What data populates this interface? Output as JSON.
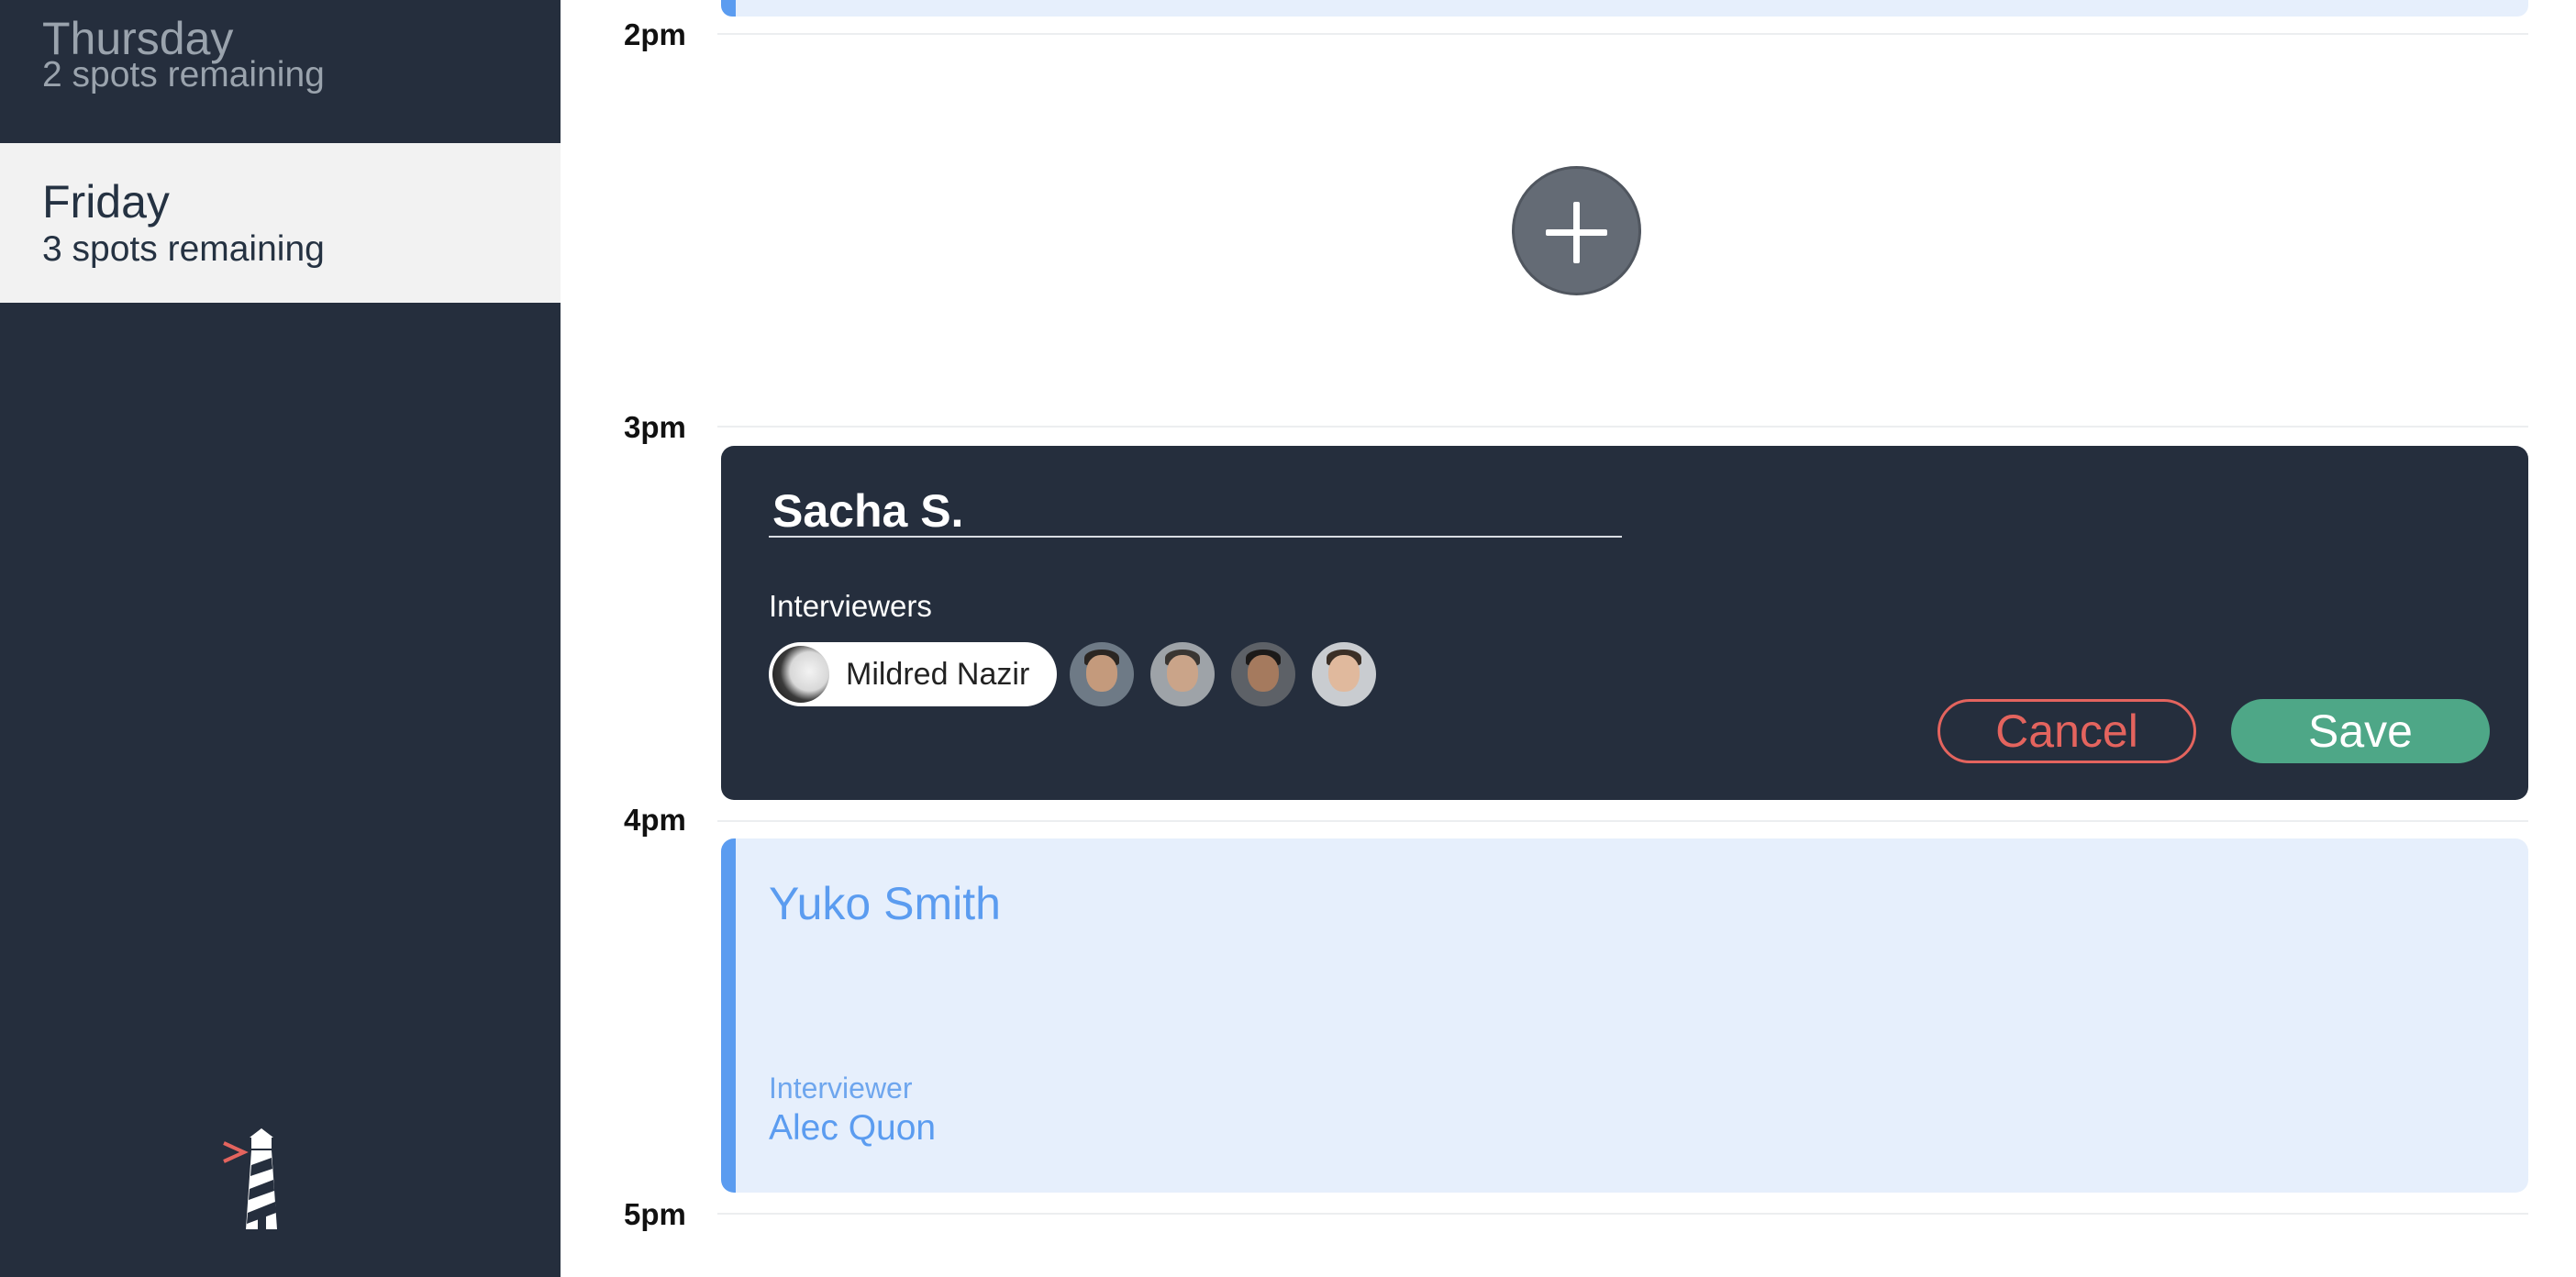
{
  "sidebar": {
    "days": [
      {
        "name": "Thursday",
        "spots": "2 spots remaining",
        "active": false
      },
      {
        "name": "Friday",
        "spots": "3 spots remaining",
        "active": true
      }
    ]
  },
  "calendar": {
    "hours": [
      "2pm",
      "3pm",
      "4pm",
      "5pm"
    ]
  },
  "editor": {
    "student_name": "Sacha S.",
    "interviewers_label": "Interviewers",
    "selected_interviewer": "Mildred Nazir",
    "cancel_label": "Cancel",
    "save_label": "Save"
  },
  "booked_slot": {
    "student_name": "Yuko Smith",
    "interviewer_label": "Interviewer",
    "interviewer_name": "Alec Quon"
  },
  "colors": {
    "sidebar_bg": "#252e3d",
    "accent_blue": "#5b9cf0",
    "slot_bg": "#e6effc",
    "cancel_red": "#e4645e",
    "save_green": "#4ea787"
  },
  "icons": {
    "add": "plus-icon",
    "logo": "lighthouse-icon"
  }
}
